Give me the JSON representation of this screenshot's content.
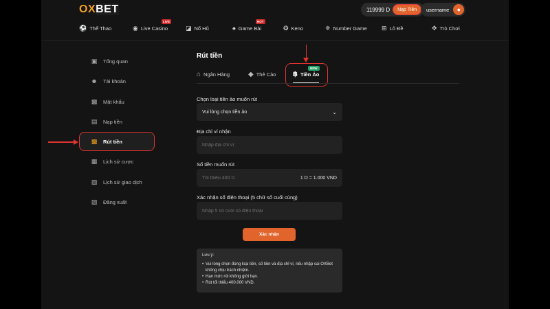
{
  "header": {
    "logo_part1": "OX",
    "logo_part2": "BET",
    "balance": "119999 D",
    "deposit_label": "Nạp Tiền",
    "username": "username"
  },
  "nav": {
    "items": [
      {
        "label": "Thể Thao",
        "icon": "soccer-ball-icon",
        "badge": ""
      },
      {
        "label": "Live Casino",
        "icon": "casino-chip-icon",
        "badge": "LIVE"
      },
      {
        "label": "Nổ Hũ",
        "icon": "slot-machine-icon",
        "badge": ""
      },
      {
        "label": "Game Bài",
        "icon": "cards-icon",
        "badge": "HOT"
      },
      {
        "label": "Keno",
        "icon": "keno-icon",
        "badge": ""
      },
      {
        "label": "Number Game",
        "icon": "number-game-icon",
        "badge": ""
      },
      {
        "label": "Lô Đề",
        "icon": "lottery-icon",
        "badge": ""
      },
      {
        "label": "Trò Chơi",
        "icon": "gamepad-icon",
        "badge": ""
      }
    ]
  },
  "sidebar": {
    "items": [
      {
        "label": "Tổng quan",
        "icon": "overview-icon"
      },
      {
        "label": "Tài khoản",
        "icon": "user-icon"
      },
      {
        "label": "Mật khẩu",
        "icon": "lock-icon"
      },
      {
        "label": "Nạp tiền",
        "icon": "deposit-icon"
      },
      {
        "label": "Rút tiền",
        "icon": "withdraw-icon"
      },
      {
        "label": "Lịch sử cược",
        "icon": "bet-history-icon"
      },
      {
        "label": "Lịch sử giao dịch",
        "icon": "transaction-history-icon"
      },
      {
        "label": "Đăng xuất",
        "icon": "logout-icon"
      }
    ],
    "active_index": 4
  },
  "main": {
    "title": "Rút tiền",
    "tabs": [
      {
        "label": "Ngân Hàng",
        "icon": "bank-icon"
      },
      {
        "label": "Thẻ Cào",
        "icon": "card-icon"
      },
      {
        "label": "Tiền Ảo",
        "icon": "bitcoin-icon",
        "badge": "NEW"
      }
    ],
    "active_tab": 2,
    "form": {
      "coin_label": "Chọn loại tiền ảo muốn rút",
      "coin_value": "Vui lòng chọn tiền ảo",
      "wallet_label": "Địa chỉ ví nhận",
      "wallet_placeholder": "Nhập địa chỉ ví",
      "amount_label": "Số tiền muốn rút",
      "amount_placeholder": "Tối thiểu 400 D",
      "amount_rate": "1 D = 1.000 VND",
      "phone_label": "Xác nhận số điện thoại (5 chữ số cuối cùng)",
      "phone_placeholder": "Nhập 5 số cuối số điện thoại",
      "confirm_label": "Xác nhận"
    },
    "note": {
      "title": "Lưu ý:",
      "items": [
        "Vui lòng chọn đúng loại tiền, số tiền và địa chỉ ví, nếu nhập sai OXBet không chịu trách nhiệm.",
        "Hạn mức rút không giới hạn.",
        "Rút tối thiểu 400.000 VND."
      ]
    }
  },
  "colors": {
    "accent": "#e0642b",
    "highlight": "#e0342f",
    "logo_yellow": "#f0a020",
    "background": "#141414"
  }
}
